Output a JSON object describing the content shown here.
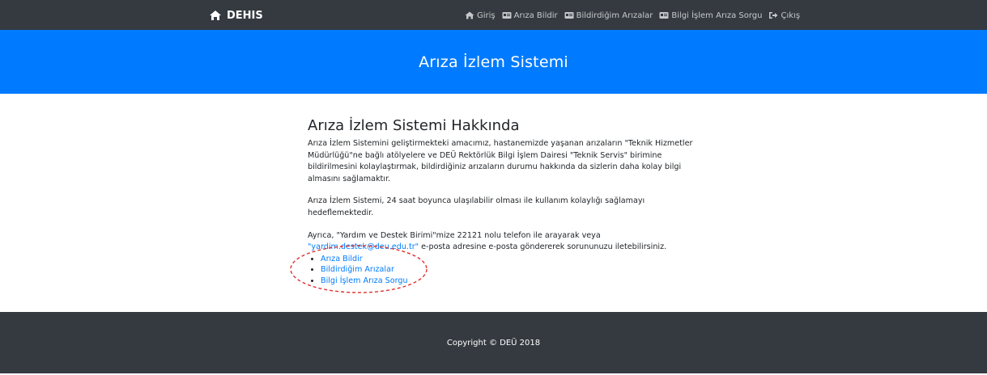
{
  "navbar": {
    "brand": "DEHIS",
    "items": [
      {
        "label": "Giriş",
        "icon": "home-icon"
      },
      {
        "label": "Arıza Bildir",
        "icon": "id-card-icon"
      },
      {
        "label": "Bildirdiğim Arızalar",
        "icon": "id-card-icon"
      },
      {
        "label": "Bilgi İşlem Arıza Sorgu",
        "icon": "id-card-icon"
      },
      {
        "label": "Çıkış",
        "icon": "sign-out-icon"
      }
    ]
  },
  "hero": {
    "title": "Arıza İzlem Sistemi"
  },
  "main": {
    "heading": "Arıza İzlem Sistemi Hakkında",
    "paragraph1": "Arıza İzlem Sistemini geliştirmekteki amacımız, hastanemizde yaşanan arızaların \"Teknik Hizmetler Müdürlüğü\"ne bağlı atölyelere ve DEÜ Rektörlük Bilgi İşlem Dairesi \"Teknik Servis\" birimine bildirilmesini kolaylaştırmak, bildirdiğiniz arızaların durumu hakkında da sizlerin daha kolay bilgi almasını sağlamaktır.",
    "paragraph2": "Arıza İzlem Sistemi, 24 saat boyunca ulaşılabilir olması ile kullanım kolaylığı sağlamayı hedeflemektedir.",
    "paragraph3_before": "Ayrıca, \"Yardım ve Destek Birimi\"mize 22121 nolu telefon ile arayarak veya ",
    "email_link": "\"yardim.destek@deu.edu.tr\"",
    "paragraph3_after": " e-posta adresine e-posta göndererek sorununuzu iletebilirsiniz.",
    "links": [
      "Arıza Bildir",
      "Bildirdiğim Arızalar",
      "Bilgi İşlem Arıza Sorgu"
    ]
  },
  "footer": {
    "copyright": "Copyright © DEÜ 2018"
  },
  "colors": {
    "navbar_bg": "#343a40",
    "hero_bg": "#007bff",
    "link": "#007bff",
    "highlight_ellipse": "#e03131"
  }
}
